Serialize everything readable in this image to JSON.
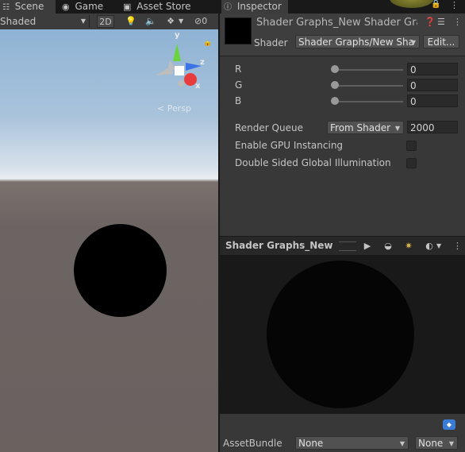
{
  "scene": {
    "tabs": [
      "Scene",
      "Game",
      "Asset Store"
    ],
    "draw_mode": "Shaded",
    "btn_2d": "2D",
    "gizmo_count": "0",
    "persp_label": "< Persp",
    "axis_y": "y",
    "axis_z": "z",
    "axis_x": "x"
  },
  "inspector": {
    "tab_label": "Inspector",
    "title": "Shader Graphs_New Shader Graph",
    "shader_label": "Shader",
    "shader_value": "Shader Graphs/New Sha",
    "edit_label": "Edit...",
    "properties": [
      {
        "label": "R",
        "value": "0"
      },
      {
        "label": "G",
        "value": "0"
      },
      {
        "label": "B",
        "value": "0"
      }
    ],
    "render_queue_label": "Render Queue",
    "render_queue_mode": "From Shader",
    "render_queue_value": "2000",
    "gpu_instancing_label": "Enable GPU Instancing",
    "double_sided_gi_label": "Double Sided Global Illumination",
    "preview_title": "Shader Graphs_New Sha",
    "assetbundle_label": "AssetBundle",
    "assetbundle_value": "None",
    "assetbundle_variant": "None"
  },
  "colors": {
    "gizmo_y": "#6ad43c",
    "gizmo_z": "#3c74e8",
    "gizmo_x": "#e83c3c",
    "tag_icon": "#3a7bd5"
  }
}
